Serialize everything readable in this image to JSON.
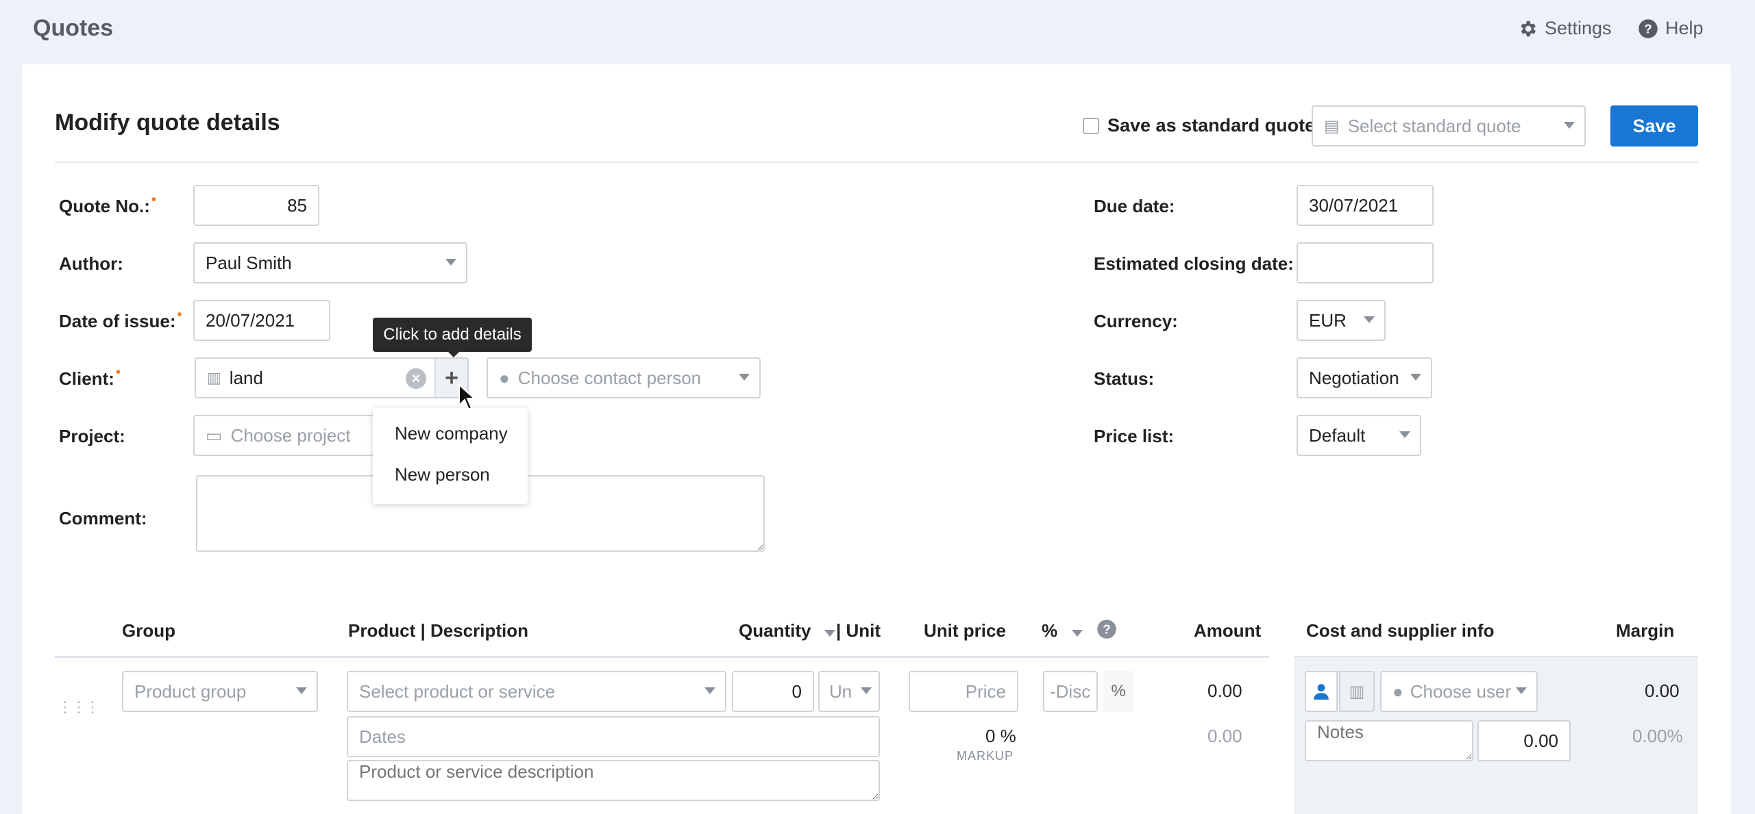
{
  "app": {
    "title": "Quotes"
  },
  "top_links": {
    "settings": "Settings",
    "help": "Help"
  },
  "header": {
    "title": "Modify quote details",
    "save_standard_label": "Save as standard quote",
    "select_standard_placeholder": "Select standard quote",
    "save_label": "Save"
  },
  "form_left": {
    "quote_no_label": "Quote No.:",
    "quote_no_value": "85",
    "author_label": "Author:",
    "author_value": "Paul Smith",
    "date_issue_label": "Date of issue:",
    "date_issue_value": "20/07/2021",
    "client_label": "Client:",
    "client_value": "land",
    "contact_placeholder": "Choose contact person",
    "project_label": "Project:",
    "project_placeholder": "Choose project",
    "comment_label": "Comment:"
  },
  "form_right": {
    "due_date_label": "Due date:",
    "due_date_value": "30/07/2021",
    "closing_label": "Estimated closing date:",
    "closing_value": "",
    "currency_label": "Currency:",
    "currency_value": "EUR",
    "status_label": "Status:",
    "status_value": "Negotiation",
    "pricelist_label": "Price list:",
    "pricelist_value": "Default"
  },
  "tooltip": {
    "text": "Click to add details"
  },
  "add_menu": {
    "items": [
      "New company",
      "New person"
    ]
  },
  "table": {
    "headers": {
      "group": "Group",
      "product": "Product | Description",
      "quantity": "Quantity",
      "unit": "| Unit",
      "unit_price": "Unit price",
      "percent": "%",
      "amount": "Amount",
      "cost_info": "Cost and supplier info",
      "margin": "Margin"
    },
    "row": {
      "group_placeholder": "Product group",
      "product_placeholder": "Select product or service",
      "quantity_value": "0",
      "unit_placeholder": "Un",
      "price_placeholder": "Price",
      "discount_placeholder": "-Disc",
      "percent_symbol": "%",
      "amount": "0.00",
      "amount_sub": "0.00",
      "dates_placeholder": "Dates",
      "description_placeholder": "Product or service description",
      "markup_value": "0 %",
      "markup_label": "MARKUP",
      "user_placeholder": "Choose user",
      "notes_placeholder": "Notes",
      "cost_value": "0.00",
      "margin_value": "0.00",
      "margin_pct": "0.00%"
    }
  },
  "colors": {
    "accent": "#1976d2",
    "required": "#f47c20"
  }
}
